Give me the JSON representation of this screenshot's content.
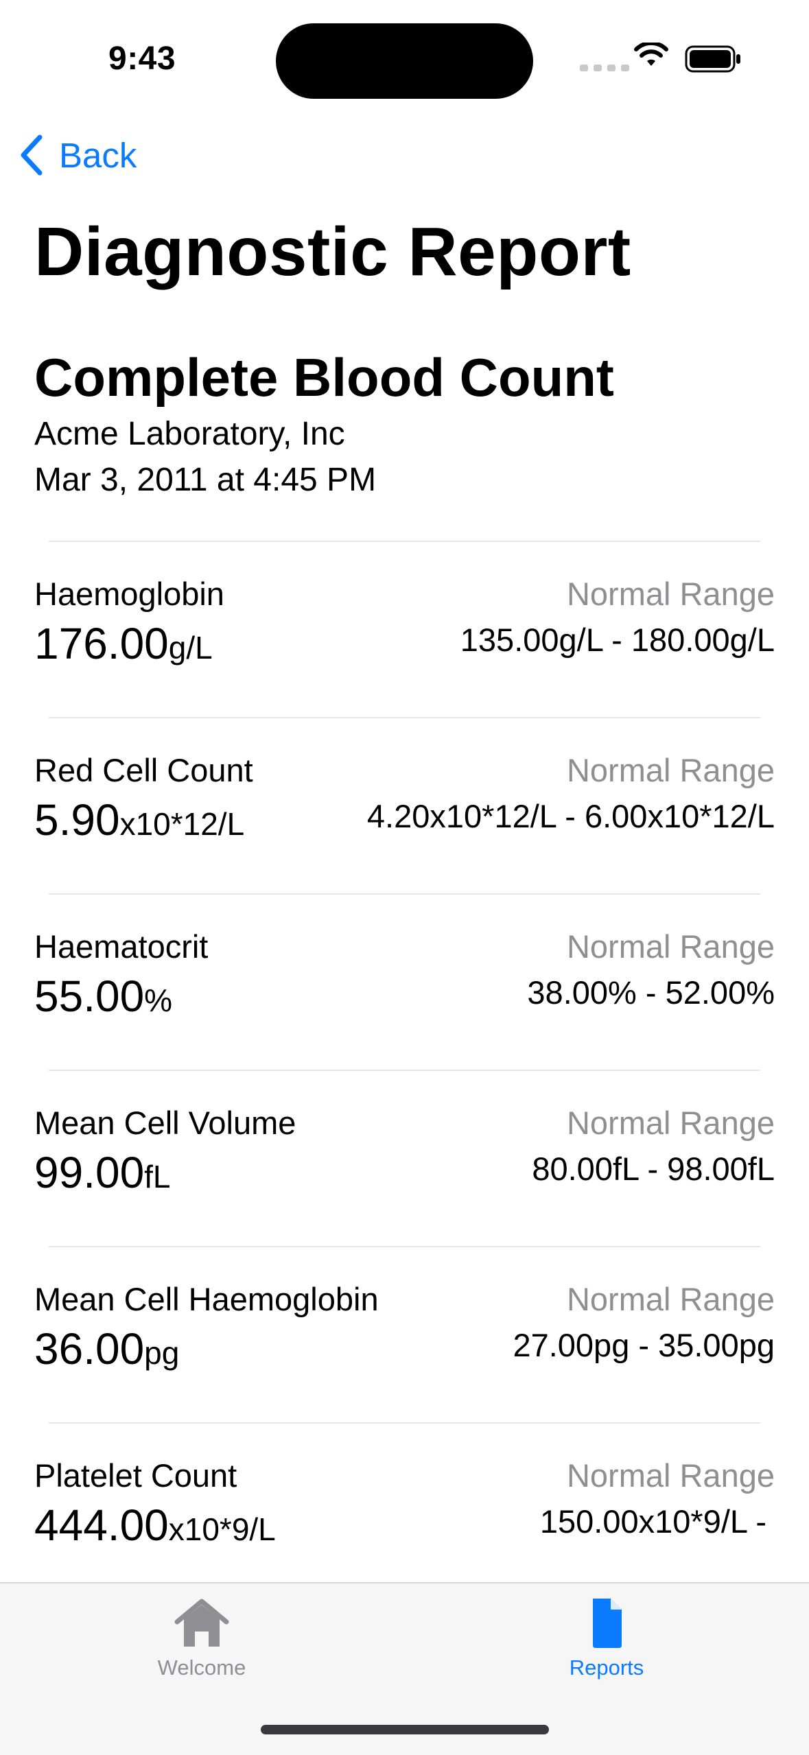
{
  "status_bar": {
    "time": "9:43"
  },
  "nav": {
    "back_label": "Back"
  },
  "page_title": "Diagnostic Report",
  "report": {
    "title": "Complete Blood Count",
    "lab": "Acme Laboratory, Inc",
    "date": "Mar 3, 2011 at 4:45 PM"
  },
  "results": [
    {
      "name": "Haemoglobin",
      "value": "176.00",
      "unit": "g/L",
      "range_label": "Normal Range",
      "range": "135.00g/L - 180.00g/L"
    },
    {
      "name": "Red Cell Count",
      "value": "5.90",
      "unit": "x10*12/L",
      "range_label": "Normal Range",
      "range": "4.20x10*12/L - 6.00x10*12/L"
    },
    {
      "name": "Haematocrit",
      "value": "55.00",
      "unit": "%",
      "range_label": "Normal Range",
      "range": "38.00% - 52.00%"
    },
    {
      "name": "Mean Cell Volume",
      "value": "99.00",
      "unit": "fL",
      "range_label": "Normal Range",
      "range": "80.00fL - 98.00fL"
    },
    {
      "name": "Mean Cell Haemoglobin",
      "value": "36.00",
      "unit": "pg",
      "range_label": "Normal Range",
      "range": "27.00pg - 35.00pg"
    },
    {
      "name": "Platelet Count",
      "value": "444.00",
      "unit": "x10*9/L",
      "range_label": "Normal Range",
      "range": "150.00x10*9/L -"
    }
  ],
  "tabs": [
    {
      "label": "Welcome",
      "icon": "house-icon",
      "selected": false
    },
    {
      "label": "Reports",
      "icon": "document-icon",
      "selected": true
    }
  ],
  "colors": {
    "accent": "#0a7aff",
    "secondary_text": "#8e8e93",
    "tab_bar_bg": "#f6f6f6"
  }
}
